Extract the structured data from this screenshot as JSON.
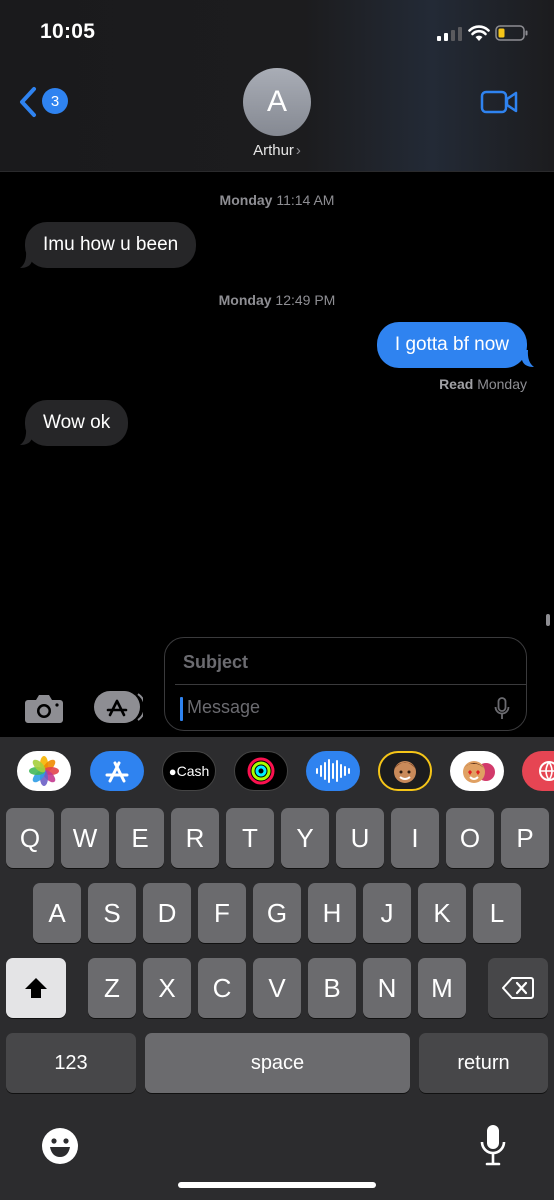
{
  "status_bar": {
    "time": "10:05"
  },
  "header": {
    "back_badge": "3",
    "avatar_initial": "A",
    "contact_name": "Arthur",
    "chevron": "›"
  },
  "conversation": {
    "timestamps": [
      {
        "day": "Monday",
        "time": "11:14 AM"
      },
      {
        "day": "Monday",
        "time": "12:49 PM"
      }
    ],
    "messages": [
      {
        "direction": "incoming",
        "text": "Imu how u been"
      },
      {
        "direction": "outgoing",
        "text": "I gotta bf now"
      },
      {
        "direction": "incoming",
        "text": "Wow ok"
      }
    ],
    "read_receipt": {
      "label": "Read",
      "when": "Monday"
    }
  },
  "compose": {
    "subject_placeholder": "Subject",
    "message_placeholder": "Message"
  },
  "app_strip": [
    {
      "name": "photos",
      "icon": "photos-icon"
    },
    {
      "name": "app-store",
      "icon": "app-store-icon"
    },
    {
      "name": "apple-cash",
      "label": "Cash",
      "icon": "apple-cash-icon"
    },
    {
      "name": "activity",
      "icon": "activity-icon"
    },
    {
      "name": "audio",
      "icon": "audio-waveform-icon"
    },
    {
      "name": "memoji",
      "icon": "memoji-icon"
    },
    {
      "name": "memoji-stickers",
      "icon": "memoji-stickers-icon"
    },
    {
      "name": "web-images",
      "icon": "globe-search-icon"
    }
  ],
  "keyboard": {
    "row1": [
      "Q",
      "W",
      "E",
      "R",
      "T",
      "Y",
      "U",
      "I",
      "O",
      "P"
    ],
    "row2": [
      "A",
      "S",
      "D",
      "F",
      "G",
      "H",
      "J",
      "K",
      "L"
    ],
    "row3": [
      "Z",
      "X",
      "C",
      "V",
      "B",
      "N",
      "M"
    ],
    "numbers_label": "123",
    "space_label": "space",
    "return_label": "return"
  },
  "colors": {
    "imessage_blue": "#2f83f0",
    "incoming_bubble": "#262628",
    "keyboard_bg": "#2c2c2e",
    "key_letter": "#6b6b6e",
    "key_function": "#474749"
  }
}
